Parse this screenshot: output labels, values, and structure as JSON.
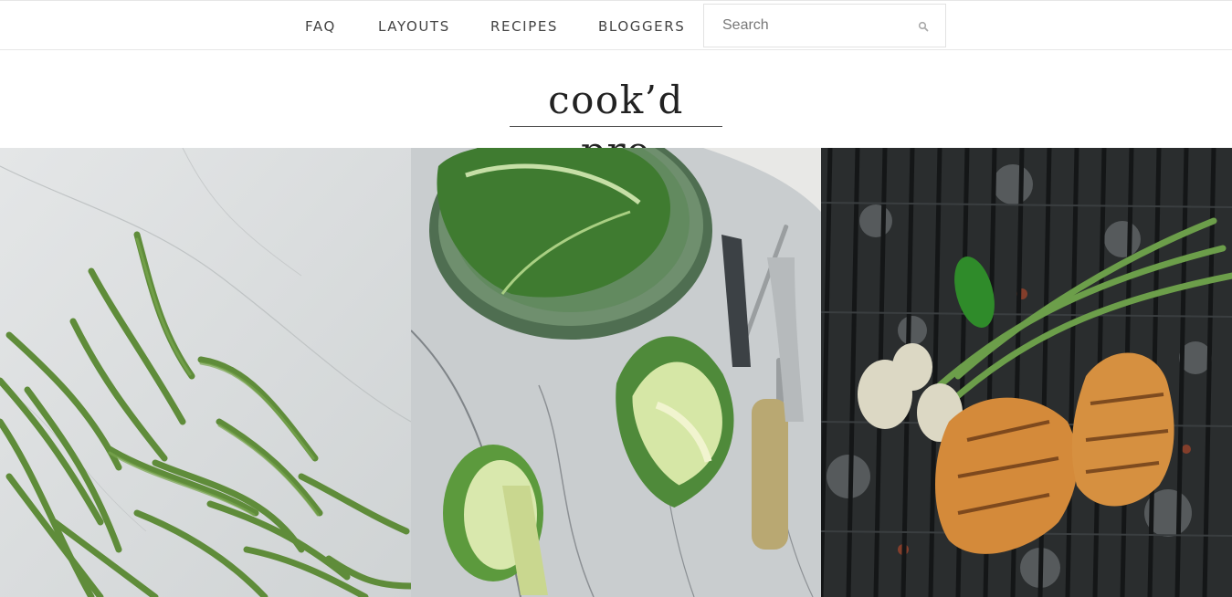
{
  "nav": {
    "items": [
      {
        "label": "FAQ"
      },
      {
        "label": "LAYOUTS"
      },
      {
        "label": "RECIPES"
      },
      {
        "label": "BLOGGERS"
      }
    ]
  },
  "search": {
    "placeholder": "Search",
    "icon": "search-icon"
  },
  "site": {
    "logo": "cook’d pro"
  },
  "gallery": {
    "tiles": [
      {
        "subject": "green beans on marble"
      },
      {
        "subject": "savoy cabbage with knife and fork"
      },
      {
        "subject": "grilled chicken and scallions"
      }
    ]
  },
  "colors": {
    "text": "#444444",
    "border": "#e6e6e6",
    "logo": "#222222"
  }
}
